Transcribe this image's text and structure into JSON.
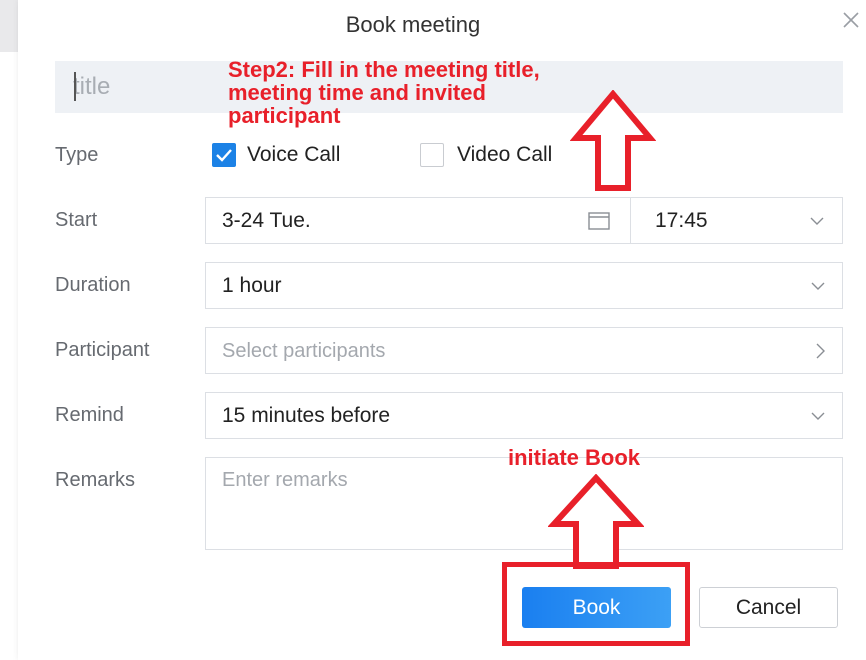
{
  "dialog": {
    "title": "Book meeting",
    "close_icon": "close-icon"
  },
  "title_field": {
    "placeholder": "title"
  },
  "type": {
    "label": "Type",
    "options": [
      {
        "label": "Voice Call",
        "checked": true
      },
      {
        "label": "Video Call",
        "checked": false
      }
    ]
  },
  "start": {
    "label": "Start",
    "date": "3-24 Tue.",
    "date_icon": "calendar-icon",
    "time": "17:45",
    "time_icon": "chevron-down-icon"
  },
  "duration": {
    "label": "Duration",
    "value": "1 hour",
    "icon": "chevron-down-icon"
  },
  "participant": {
    "label": "Participant",
    "placeholder": "Select participants",
    "icon": "chevron-right-icon"
  },
  "remind": {
    "label": "Remind",
    "value": "15 minutes before",
    "icon": "chevron-down-icon"
  },
  "remarks": {
    "label": "Remarks",
    "placeholder": "Enter remarks"
  },
  "buttons": {
    "book": "Book",
    "cancel": "Cancel"
  },
  "annotations": {
    "step2_line1": "Step2: Fill in the meeting title,",
    "step2_line2": "meeting time and invited",
    "step2_line3": "participant",
    "initiate": "initiate Book"
  },
  "colors": {
    "accent": "#1c82e6",
    "annotation": "#e8202a"
  }
}
